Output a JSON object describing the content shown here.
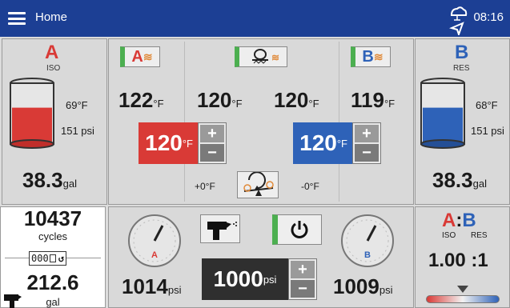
{
  "header": {
    "title": "Home",
    "time": "08:16",
    "menu_icon": "hamburger-menu-icon",
    "network_icon": "network-status-icon"
  },
  "colors": {
    "header": "#1c3f94",
    "side_a": "#d93a36",
    "side_b": "#2e62b8",
    "zone_on": "#4caf50",
    "dark": "#2f2f2f"
  },
  "left_tank": {
    "letter": "A",
    "sub": "ISO",
    "temp": "69°F",
    "pressure": "151 psi",
    "volume": "38.3",
    "volume_unit": "gal",
    "level": 0.6
  },
  "right_tank": {
    "letter": "B",
    "sub": "RES",
    "temp": "68°F",
    "pressure": "151 psi",
    "volume": "38.3",
    "volume_unit": "gal",
    "level": 0.6
  },
  "heat_zones": {
    "a_label": "A",
    "hose_label": "",
    "b_label": "B",
    "readings": [
      {
        "value": "122",
        "unit": "°F"
      },
      {
        "value": "120",
        "unit": "°F"
      },
      {
        "value": "120",
        "unit": "°F"
      },
      {
        "value": "119",
        "unit": "°F"
      }
    ],
    "a_setpoint": "120",
    "a_setpoint_unit": "°F",
    "b_setpoint": "120",
    "b_setpoint_unit": "°F",
    "a_offset": "+0°F",
    "b_offset": "-0°F"
  },
  "cycles": {
    "count": "10437",
    "label": "cycles",
    "counter_digits": "000",
    "total": "212.6",
    "total_unit": "gal"
  },
  "pressure": {
    "a_value": "1014",
    "a_unit": "psi",
    "a_label": "A",
    "b_value": "1009",
    "b_unit": "psi",
    "b_label": "B",
    "setpoint": "1000",
    "setpoint_unit": "psi"
  },
  "ratio": {
    "a": "A",
    "colon": ":",
    "b": "B",
    "a_sub": "ISO",
    "b_sub": "RES",
    "value": "1.00 :1"
  },
  "stepper": {
    "plus": "+",
    "minus": "−"
  },
  "degF": "°F"
}
